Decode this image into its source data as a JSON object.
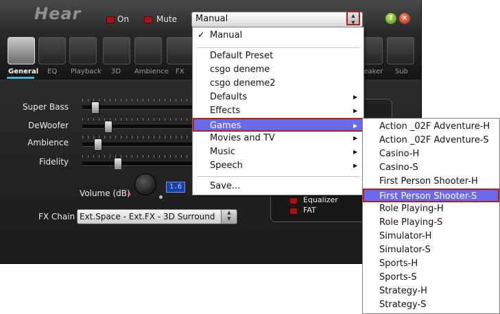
{
  "app": {
    "title": "Hear",
    "on_label": "On",
    "mute_label": "Mute"
  },
  "tabs": [
    {
      "label": "General",
      "active": true
    },
    {
      "label": "EQ"
    },
    {
      "label": "Playback"
    },
    {
      "label": "3D"
    },
    {
      "label": "Ambience"
    },
    {
      "label": "FX"
    },
    {
      "label": "peaker"
    },
    {
      "label": "Sub"
    }
  ],
  "sliders": [
    {
      "label": "Super Bass",
      "level": 0.08
    },
    {
      "label": "DeWoofer",
      "level": 0.2
    },
    {
      "label": "Ambience",
      "level": 0.11
    },
    {
      "label": "Fidelity",
      "level": 0.29
    }
  ],
  "volume": {
    "label": "Volume (dB)",
    "value": "1.6"
  },
  "fx_chain": {
    "label": "FX Chain",
    "value": "Ext.Space - Ext.FX - 3D Surround"
  },
  "options": [
    {
      "label": "Equalizer"
    },
    {
      "label": "FAT"
    }
  ],
  "preset_combo": {
    "value": "Manual"
  },
  "menu": {
    "items": [
      {
        "label": "Manual",
        "checked": true,
        "check_glyph": "✓"
      },
      {
        "label": "Default Preset"
      },
      {
        "label": "csgo deneme"
      },
      {
        "label": "csgo deneme2"
      },
      {
        "label": "Defaults",
        "submenu": true
      },
      {
        "label": "Effects",
        "submenu": true
      },
      {
        "label": "Games",
        "submenu": true,
        "highlighted": true
      },
      {
        "label": "Movies and TV",
        "submenu": true
      },
      {
        "label": "Music",
        "submenu": true
      },
      {
        "label": "Speech",
        "submenu": true
      },
      {
        "label": "Save..."
      }
    ],
    "submenu_arrow": "▶"
  },
  "games_submenu": {
    "items": [
      "Action _02F Adventure-H",
      "Action _02F Adventure-S",
      "Casino-H",
      "Casino-S",
      "First Person Shooter-H",
      "First Person Shooter-S",
      "Role Playing-H",
      "Role Playing-S",
      "Simulator-H",
      "Simulator-S",
      "Sports-H",
      "Sports-S",
      "Strategy-H",
      "Strategy-S"
    ],
    "highlighted_index": 5
  },
  "colors": {
    "highlight": "#6a6aef",
    "focus_border": "#b01e1e",
    "accent": "#39b7d8"
  }
}
